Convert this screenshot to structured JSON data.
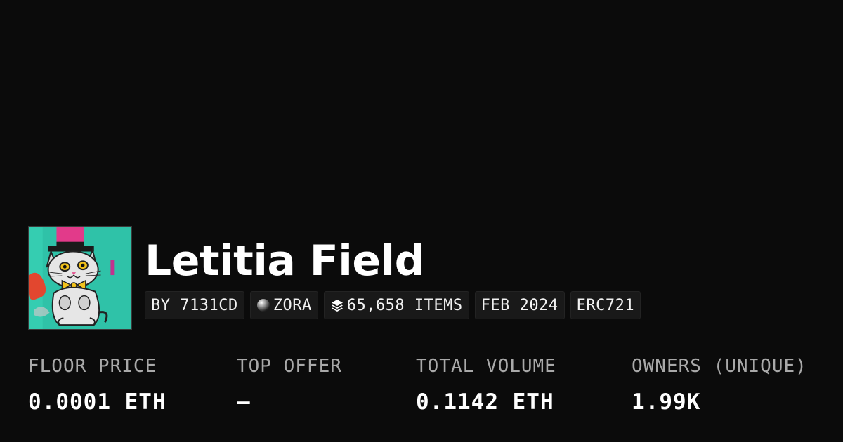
{
  "collection": {
    "name": "Letitia Field",
    "chips": {
      "creator": "BY 7131CD",
      "chain": "ZORA",
      "items": "65,658 ITEMS",
      "date": "FEB 2024",
      "standard": "ERC721"
    },
    "icons": {
      "chain": "zora-orb-icon",
      "items": "layers-icon"
    }
  },
  "stats": [
    {
      "label": "FLOOR PRICE",
      "value": "0.0001 ETH"
    },
    {
      "label": "TOP OFFER",
      "value": "—"
    },
    {
      "label": "TOTAL VOLUME",
      "value": "0.1142 ETH"
    },
    {
      "label": "OWNERS (UNIQUE)",
      "value": "1.99K"
    }
  ],
  "colors": {
    "background": "#0b0b0b",
    "chip_background": "#191919",
    "label": "#a9a9a9",
    "thumbnail_background": "#2fc2a8"
  }
}
